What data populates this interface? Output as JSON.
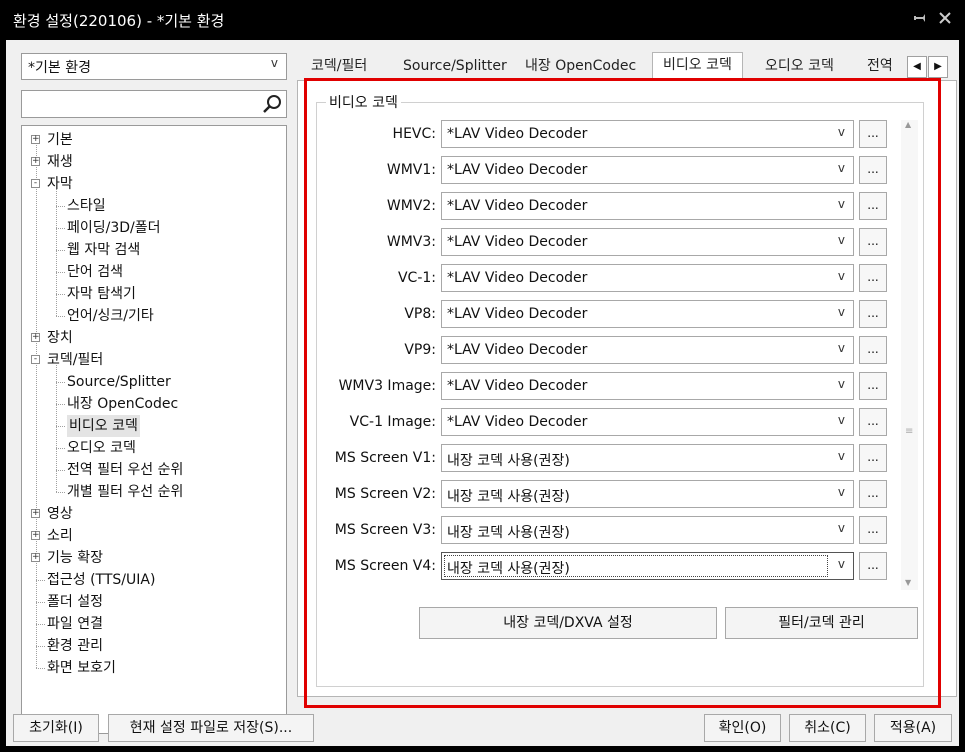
{
  "window": {
    "title": "환경 설정(220106) - *기본 환경",
    "pin_icon": "pin-icon",
    "close_icon": "close-icon"
  },
  "profile_select": {
    "value": "*기본 환경",
    "arrow": "v"
  },
  "search": {
    "placeholder": "",
    "icon": "magnifier-icon"
  },
  "tree": {
    "items": [
      {
        "label": "기본",
        "level": 0,
        "expander": "+"
      },
      {
        "label": "재생",
        "level": 0,
        "expander": "+"
      },
      {
        "label": "자막",
        "level": 0,
        "expander": "-"
      },
      {
        "label": "스타일",
        "level": 1
      },
      {
        "label": "페이딩/3D/폴더",
        "level": 1
      },
      {
        "label": "웹 자막 검색",
        "level": 1
      },
      {
        "label": "단어 검색",
        "level": 1
      },
      {
        "label": "자막 탐색기",
        "level": 1
      },
      {
        "label": "언어/싱크/기타",
        "level": 1
      },
      {
        "label": "장치",
        "level": 0,
        "expander": "+"
      },
      {
        "label": "코덱/필터",
        "level": 0,
        "expander": "-"
      },
      {
        "label": "Source/Splitter",
        "level": 1
      },
      {
        "label": "내장 OpenCodec",
        "level": 1
      },
      {
        "label": "비디오 코덱",
        "level": 1,
        "selected": true
      },
      {
        "label": "오디오 코덱",
        "level": 1
      },
      {
        "label": "전역 필터 우선 순위",
        "level": 1
      },
      {
        "label": "개별 필터 우선 순위",
        "level": 1
      },
      {
        "label": "영상",
        "level": 0,
        "expander": "+"
      },
      {
        "label": "소리",
        "level": 0,
        "expander": "+"
      },
      {
        "label": "기능 확장",
        "level": 0,
        "expander": "+"
      },
      {
        "label": "접근성 (TTS/UIA)",
        "level": 0
      },
      {
        "label": "폴더 설정",
        "level": 0
      },
      {
        "label": "파일 연결",
        "level": 0
      },
      {
        "label": "환경 관리",
        "level": 0
      },
      {
        "label": "화면 보호기",
        "level": 0
      }
    ]
  },
  "tabs": [
    {
      "label": "코덱/필터"
    },
    {
      "label": "Source/Splitter"
    },
    {
      "label": "내장 OpenCodec"
    },
    {
      "label": "비디오 코덱",
      "active": true
    },
    {
      "label": "오디오 코덱"
    },
    {
      "label": "전역"
    }
  ],
  "tab_scroll": {
    "left": "◀",
    "right": "▶"
  },
  "group": {
    "title": "비디오 코덱",
    "rows": [
      {
        "label": "HEVC:",
        "value": "*LAV Video Decoder"
      },
      {
        "label": "WMV1:",
        "value": "*LAV Video Decoder"
      },
      {
        "label": "WMV2:",
        "value": "*LAV Video Decoder"
      },
      {
        "label": "WMV3:",
        "value": "*LAV Video Decoder"
      },
      {
        "label": "VC-1:",
        "value": "*LAV Video Decoder"
      },
      {
        "label": "VP8:",
        "value": "*LAV Video Decoder"
      },
      {
        "label": "VP9:",
        "value": "*LAV Video Decoder"
      },
      {
        "label": "WMV3 Image:",
        "value": "*LAV Video Decoder"
      },
      {
        "label": "VC-1 Image:",
        "value": "*LAV Video Decoder"
      },
      {
        "label": "MS Screen V1:",
        "value": "내장 코덱 사용(권장)"
      },
      {
        "label": "MS Screen V2:",
        "value": "내장 코덱 사용(권장)"
      },
      {
        "label": "MS Screen V3:",
        "value": "내장 코덱 사용(권장)"
      },
      {
        "label": "MS Screen V4:",
        "value": "내장 코덱 사용(권장)"
      }
    ],
    "combo_arrow": "v",
    "more_label": "...",
    "dxva_button": "내장 코덱/DXVA 설정",
    "filter_button": "필터/코덱 관리"
  },
  "footer": {
    "reset": "초기화(I)",
    "save_profile": "현재 설정 파일로 저장(S)...",
    "ok": "확인(O)",
    "cancel": "취소(C)",
    "apply": "적용(A)"
  },
  "colors": {
    "highlight": "#e00000",
    "titlebar": "#000000",
    "client": "#f0f0f0"
  }
}
